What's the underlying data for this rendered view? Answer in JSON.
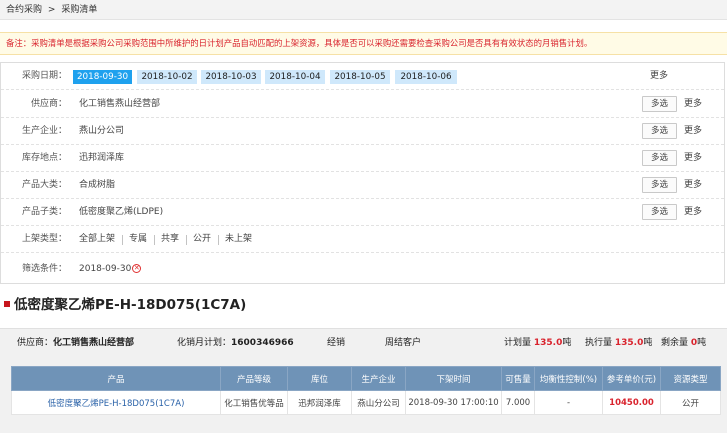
{
  "breadcrumb": {
    "root": "合约采购",
    "separator": ">",
    "current": "采购清单"
  },
  "notice": "备注：采购清单是根据采购公司采购范围中所维护的日计划产品自动匹配的上架资源，具体是否可以采购还需要检查采购公司是否具有有效状态的月销售计划。",
  "filters": {
    "date": {
      "label": "采购日期：",
      "options": [
        "2018-09-30",
        "2018-10-02",
        "2018-10-03",
        "2018-10-04",
        "2018-10-05",
        "2018-10-06"
      ],
      "selected": "2018-09-30",
      "more": "更多"
    },
    "supplier": {
      "label": "供应商：",
      "value": "化工销售燕山经营部",
      "multi": "多选",
      "more": "更多"
    },
    "manufacturer": {
      "label": "生产企业：",
      "value": "燕山分公司",
      "multi": "多选",
      "more": "更多"
    },
    "warehouse": {
      "label": "库存地点：",
      "value": "迅邦润泽库",
      "multi": "多选",
      "more": "更多"
    },
    "category": {
      "label": "产品大类：",
      "value": "合成树脂",
      "multi": "多选",
      "more": "更多"
    },
    "subcategory": {
      "label": "产品子类：",
      "value": "低密度聚乙烯(LDPE)",
      "multi": "多选",
      "more": "更多"
    },
    "listing_type": {
      "label": "上架类型：",
      "options": [
        "全部上架",
        "专属",
        "共享",
        "公开",
        "未上架"
      ]
    },
    "condition": {
      "label": "筛选条件：",
      "value": "2018-09-30",
      "clear_icon": "close-circle-icon"
    }
  },
  "product": {
    "title": "低密度聚乙烯PE-H-18D075(1C7A)",
    "supplier_label": "供应商：",
    "supplier": "化工销售燕山经营部",
    "monthly_plan_label": "化销月计划：",
    "monthly_plan": "1600346966",
    "sales_mode": "经销",
    "customer_type": "周结客户",
    "planned_label": "计划量",
    "planned": "135.0",
    "executed_label": "执行量",
    "executed": "135.0",
    "remaining_label": "剩余量",
    "remaining": "0",
    "unit": "吨"
  },
  "table": {
    "headers": [
      "产品",
      "产品等级",
      "库位",
      "生产企业",
      "下架时间",
      "可售量",
      "均衡性控制(%)",
      "参考单价(元)",
      "资源类型"
    ],
    "rows": [
      [
        "低密度聚乙烯PE-H-18D075(1C7A)",
        "化工销售优等品",
        "迅邦润泽库",
        "燕山分公司",
        "2018-09-30 17:00:10",
        "7.000",
        "-",
        "10450.00",
        "公开"
      ]
    ]
  },
  "colors": {
    "accent": "#1fa1ee",
    "danger": "#d9232d",
    "table_header": "#6f93b7"
  }
}
